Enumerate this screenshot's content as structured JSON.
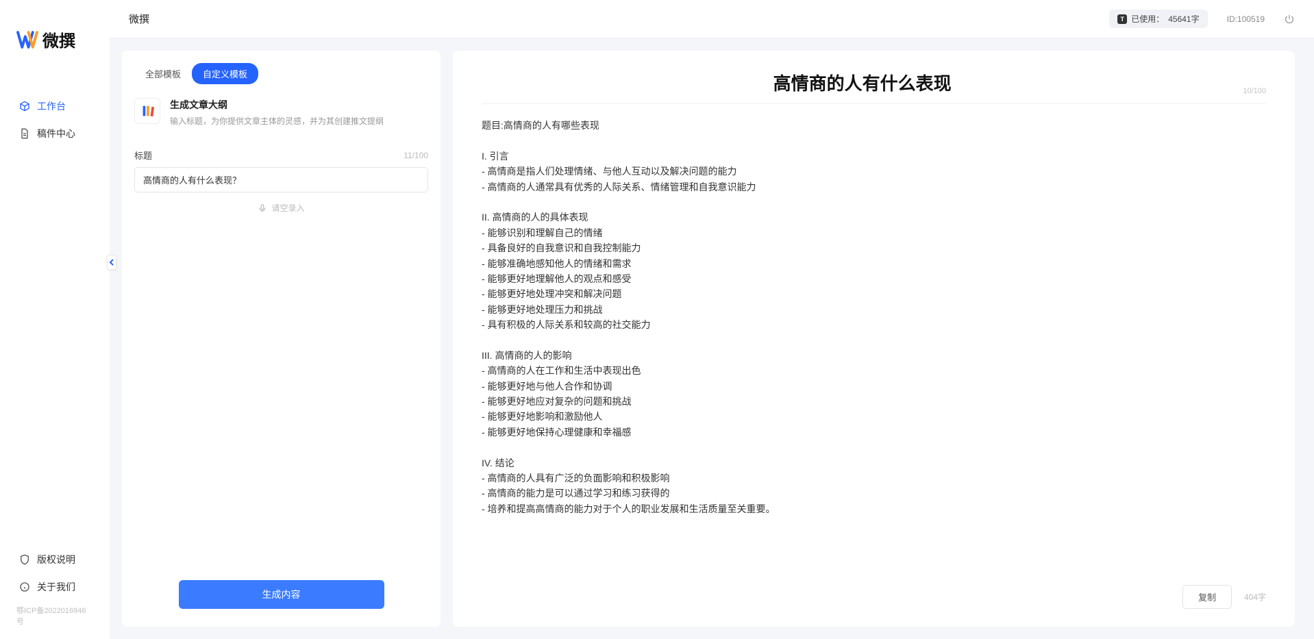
{
  "app": {
    "logo_text": "微撰",
    "header_title": "微撰"
  },
  "header": {
    "usage_label": "已使用：",
    "usage_value": "45641字",
    "user_id": "ID:100519"
  },
  "sidebar": {
    "items": [
      {
        "label": "工作台",
        "active": true
      },
      {
        "label": "稿件中心",
        "active": false
      }
    ],
    "bottom": [
      {
        "label": "版权说明"
      },
      {
        "label": "关于我们"
      }
    ],
    "icp": "鄂ICP备2022016946号"
  },
  "left": {
    "tabs": [
      {
        "label": "全部模板",
        "active": false
      },
      {
        "label": "自定义模板",
        "active": true
      }
    ],
    "template": {
      "title": "生成文章大纲",
      "desc": "输入标题，为你提供文章主体的灵感，并为其创建推文提纲"
    },
    "field_label": "标题",
    "char_count": "11/100",
    "input_value": "高情商的人有什么表现？",
    "voice_hint": "请空录入",
    "generate_btn": "生成内容"
  },
  "right": {
    "title": "高情商的人有什么表现",
    "title_count": "10/100",
    "body": "题目:高情商的人有哪些表现\n\nI. 引言\n- 高情商是指人们处理情绪、与他人互动以及解决问题的能力\n- 高情商的人通常具有优秀的人际关系、情绪管理和自我意识能力\n\nII. 高情商的人的具体表现\n- 能够识别和理解自己的情绪\n- 具备良好的自我意识和自我控制能力\n- 能够准确地感知他人的情绪和需求\n- 能够更好地理解他人的观点和感受\n- 能够更好地处理冲突和解决问题\n- 能够更好地处理压力和挑战\n- 具有积极的人际关系和较高的社交能力\n\nIII. 高情商的人的影响\n- 高情商的人在工作和生活中表现出色\n- 能够更好地与他人合作和协调\n- 能够更好地应对复杂的问题和挑战\n- 能够更好地影响和激励他人\n- 能够更好地保持心理健康和幸福感\n\nIV. 结论\n- 高情商的人具有广泛的负面影响和积极影响\n- 高情商的能力是可以通过学习和练习获得的\n- 培养和提高高情商的能力对于个人的职业发展和生活质量至关重要。",
    "copy_btn": "复制",
    "word_count": "404字"
  }
}
